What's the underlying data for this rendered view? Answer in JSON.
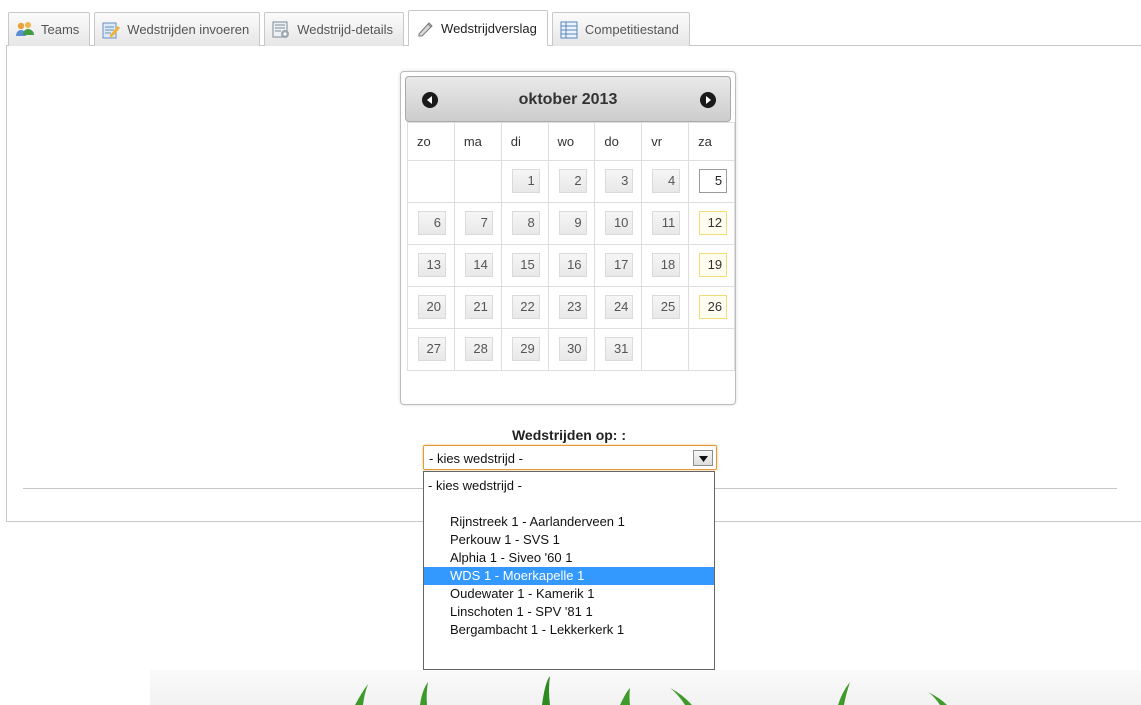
{
  "tabs": [
    {
      "label": "Teams",
      "icon": "teams-icon",
      "active": false
    },
    {
      "label": "Wedstrijden invoeren",
      "icon": "edit-matches-icon",
      "active": false
    },
    {
      "label": "Wedstrijd-details",
      "icon": "details-icon",
      "active": false
    },
    {
      "label": "Wedstrijdverslag",
      "icon": "report-icon",
      "active": true
    },
    {
      "label": "Competitiestand",
      "icon": "standings-icon",
      "active": false
    }
  ],
  "calendar": {
    "title": "oktober 2013",
    "weekdays": [
      "zo",
      "ma",
      "di",
      "wo",
      "do",
      "vr",
      "za"
    ],
    "weeks": [
      [
        "",
        "",
        "1",
        "2",
        "3",
        "4",
        "5"
      ],
      [
        "6",
        "7",
        "8",
        "9",
        "10",
        "11",
        "12"
      ],
      [
        "13",
        "14",
        "15",
        "16",
        "17",
        "18",
        "19"
      ],
      [
        "20",
        "21",
        "22",
        "23",
        "24",
        "25",
        "26"
      ],
      [
        "27",
        "28",
        "29",
        "30",
        "31",
        "",
        ""
      ]
    ],
    "today": "5"
  },
  "matches": {
    "label": "Wedstrijden op: :",
    "selected_value": "- kies wedstrijd -",
    "options": [
      {
        "label": "- kies wedstrijd -",
        "indented": false,
        "selected": false
      },
      {
        "label": "",
        "indented": true,
        "selected": false
      },
      {
        "label": "Rijnstreek 1 - Aarlanderveen 1",
        "indented": true,
        "selected": false
      },
      {
        "label": "Perkouw 1 - SVS 1",
        "indented": true,
        "selected": false
      },
      {
        "label": "Alphia 1 - Siveo '60 1",
        "indented": true,
        "selected": false
      },
      {
        "label": "WDS 1 - Moerkapelle 1",
        "indented": true,
        "selected": true
      },
      {
        "label": "Oudewater 1 - Kamerik 1",
        "indented": true,
        "selected": false
      },
      {
        "label": "Linschoten 1 - SPV '81 1",
        "indented": true,
        "selected": false
      },
      {
        "label": "Bergambacht 1 - Lekkerkerk 1",
        "indented": true,
        "selected": false
      }
    ]
  },
  "colors": {
    "selection": "#3399ff",
    "select_focus_border": "#e19b3b",
    "saturday_border": "#f1dc7a"
  }
}
